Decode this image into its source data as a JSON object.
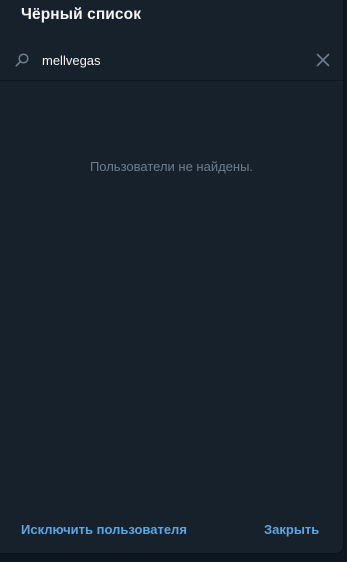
{
  "dialog": {
    "title": "Чёрный список"
  },
  "search": {
    "value": "mellvegas",
    "icon": "search-icon",
    "clear_icon": "close-icon"
  },
  "main": {
    "empty_message": "Пользователи не найдены."
  },
  "footer": {
    "exclude_label": "Исключить пользователя",
    "close_label": "Закрыть"
  },
  "colors": {
    "background": "#17212b",
    "accent": "#5fa6e0",
    "text": "#f5f5f5",
    "muted": "#6d7f8f"
  }
}
